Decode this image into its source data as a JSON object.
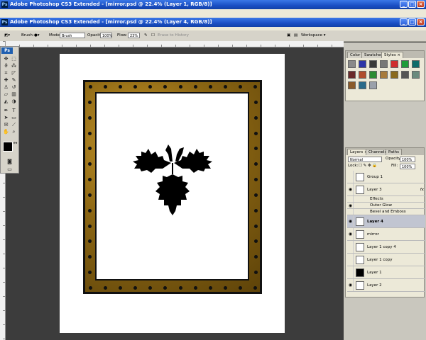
{
  "window1": {
    "title": "Adobe Photoshop CS3 Extended - [mirror.psd @ 22.4% (Layer 1, RGB/8)]"
  },
  "window2": {
    "title": "Adobe Photoshop CS3 Extended - [mirror.psd @ 22.4% (Layer 4, RGB/8)]"
  },
  "options": {
    "brush_label": "Brush:",
    "mode_label": "Mode:",
    "mode_value": "Brush",
    "opacity_label": "Opacity:",
    "opacity_value": "100%",
    "flow_label": "Flow:",
    "flow_value": "23%",
    "erase_history": "Erase to History",
    "workspace": "Workspace ▾"
  },
  "toolbox": {
    "app_badge": "Ps"
  },
  "color_panel": {
    "tabs": [
      "Color",
      "Swatches",
      "Styles ×"
    ],
    "styles": [
      "#8a8a8a",
      "#2d36a8",
      "#3a3a3a",
      "#777777",
      "#cf2d2d",
      "#1e9b38",
      "#0e6b6b",
      "#6a2a2a",
      "#b04b2e",
      "#2c8c34",
      "#a77a3c",
      "#8a6a1e",
      "#555555",
      "#6a8a7e",
      "#8a5a2a",
      "#2a6a8a",
      "#9aa0aa"
    ]
  },
  "layers_panel": {
    "tabs": [
      "Layers ×",
      "Channels",
      "Paths"
    ],
    "blend_mode": "Normal",
    "opacity_label": "Opacity:",
    "opacity_value": "100%",
    "lock_label": "Lock:",
    "fill_label": "Fill:",
    "fill_value": "100%",
    "layers": [
      {
        "name": "Group 1",
        "visible": false
      },
      {
        "name": "Layer 3",
        "visible": true,
        "fx": "fx"
      },
      {
        "name": "Effects",
        "visible": false,
        "sub": true
      },
      {
        "name": "Outer Glow",
        "visible": true,
        "sub": true
      },
      {
        "name": "Bevel and Emboss",
        "visible": false,
        "sub": true
      },
      {
        "name": "Layer 4",
        "visible": true,
        "selected": true
      },
      {
        "name": "mirror",
        "visible": true
      },
      {
        "name": "Layer 1 copy 4",
        "visible": false
      },
      {
        "name": "Layer 1 copy",
        "visible": false
      },
      {
        "name": "Layer 1",
        "visible": false
      },
      {
        "name": "Layer 2",
        "visible": true
      }
    ]
  }
}
